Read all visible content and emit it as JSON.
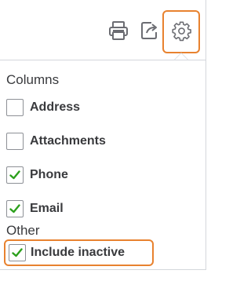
{
  "toolbar": {
    "icons": [
      "printer-icon",
      "export-icon",
      "gear-icon"
    ]
  },
  "columns": {
    "title": "Columns",
    "items": [
      {
        "label": "Address",
        "checked": false
      },
      {
        "label": "Attachments",
        "checked": false
      },
      {
        "label": "Phone",
        "checked": true
      },
      {
        "label": "Email",
        "checked": true
      }
    ]
  },
  "other": {
    "title": "Other",
    "items": [
      {
        "label": "Include inactive",
        "checked": true
      }
    ]
  },
  "colors": {
    "highlight": "#e8822f",
    "check": "#2ca01c",
    "border": "#d4d7dc",
    "icon": "#6b6c72",
    "text": "#393a3d"
  }
}
